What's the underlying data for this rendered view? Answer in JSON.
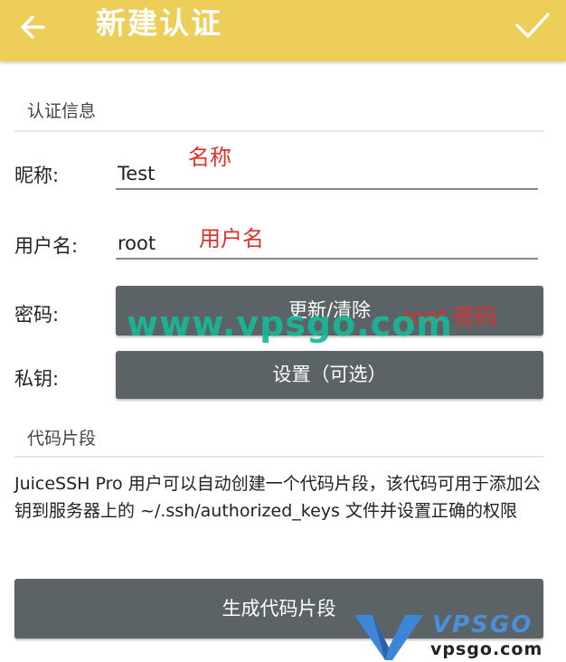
{
  "header": {
    "title": "新建认证",
    "back_icon": "arrow-left-icon",
    "confirm_icon": "check-icon"
  },
  "auth_section": {
    "title": "认证信息",
    "nickname": {
      "label": "昵称:",
      "value": "Test"
    },
    "username": {
      "label": "用户名:",
      "value": "root"
    },
    "password": {
      "label": "密码:",
      "button": "更新/清除"
    },
    "private_key": {
      "label": "私钥:",
      "button": "设置（可选）"
    }
  },
  "snippet_section": {
    "title": "代码片段",
    "description": "JuiceSSH Pro 用户可以自动创建一个代码片段，该代码可用于添加公钥到服务器上的 ~/.ssh/authorized_keys 文件并设置正确的权限",
    "generate_button": "生成代码片段"
  },
  "annotations": {
    "nickname": "名称",
    "username": "用户名",
    "password": "root 密码",
    "color": "#e0302a"
  },
  "watermark": {
    "text": "www.vpsgo.com",
    "logo_brand": "VPSGO",
    "logo_url": "vpsgo.com"
  },
  "colors": {
    "topbar": "#ecce58",
    "button": "#5c6367",
    "watermark": "#18b898"
  }
}
